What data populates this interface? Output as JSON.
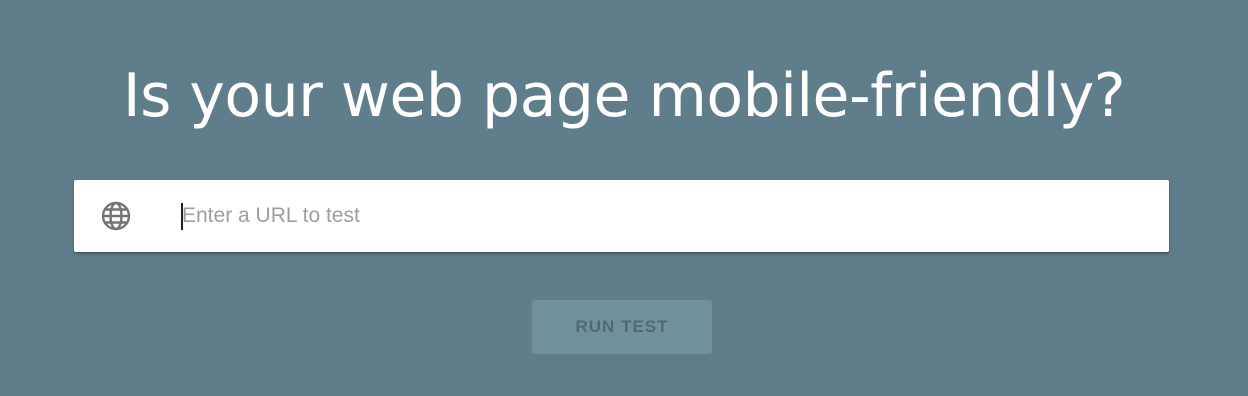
{
  "page": {
    "headline": "Is your web page mobile-friendly?"
  },
  "search": {
    "icon": "globe-icon",
    "placeholder": "Enter a URL to test",
    "value": ""
  },
  "actions": {
    "run_label": "RUN TEST"
  },
  "colors": {
    "background": "#607d8b",
    "input_background": "#ffffff",
    "placeholder": "#9e9e9e",
    "button_background": "#71909d",
    "button_text": "#4f6a76"
  }
}
